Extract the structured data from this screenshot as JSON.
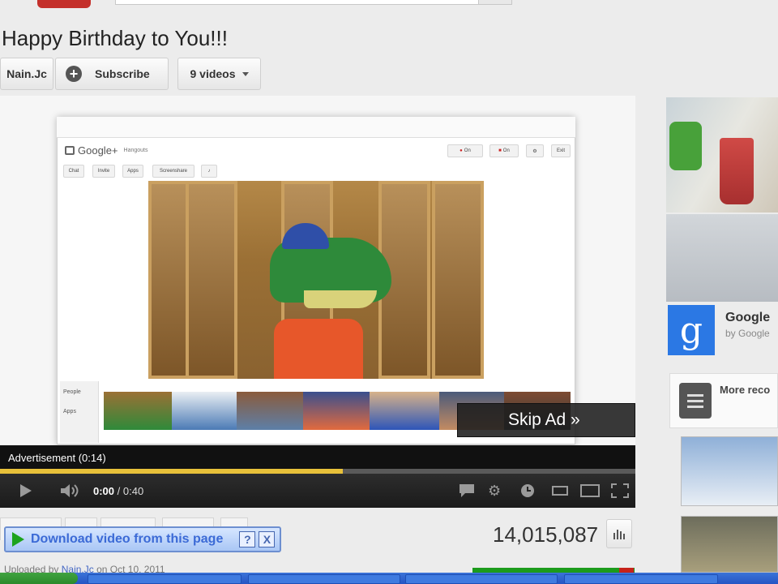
{
  "header": {
    "video_title": "Happy Birthday to You!!!",
    "channel_name": "Nain.Jc",
    "subscribe_label": "Subscribe",
    "videos_dropdown": "9 videos"
  },
  "player": {
    "hangout_brand": "Google+",
    "hangout_product": "Hangouts",
    "hangout_toolbar": [
      "Chat",
      "Invite",
      "Apps",
      "Screenshare"
    ],
    "hangout_top_buttons": [
      "On",
      "On",
      "Exit"
    ],
    "hangout_side_tabs": [
      "People",
      "Apps"
    ],
    "skip_ad_label": "Skip Ad »",
    "ad_label": "Advertisement (0:14)",
    "current_time": "0:00",
    "duration": "0:40",
    "ad_progress": 0.54
  },
  "below_player": {
    "download_label": "Download video from this page",
    "help_label": "?",
    "close_label": "X",
    "view_count": "14,015,087",
    "uploaded_prefix": "Uploaded by",
    "uploader": "Nain.Jc",
    "uploaded_date": "on Oct 10, 2011"
  },
  "sidebar": {
    "ad_title": "Google",
    "ad_byline": "by Google",
    "more_label": "More reco"
  },
  "colors": {
    "brand_red": "#c4302b",
    "progress_yellow": "#e8c13a",
    "likes_green": "#1c9b1c",
    "dislikes_red": "#c6221a",
    "google_blue": "#2b78e4"
  }
}
